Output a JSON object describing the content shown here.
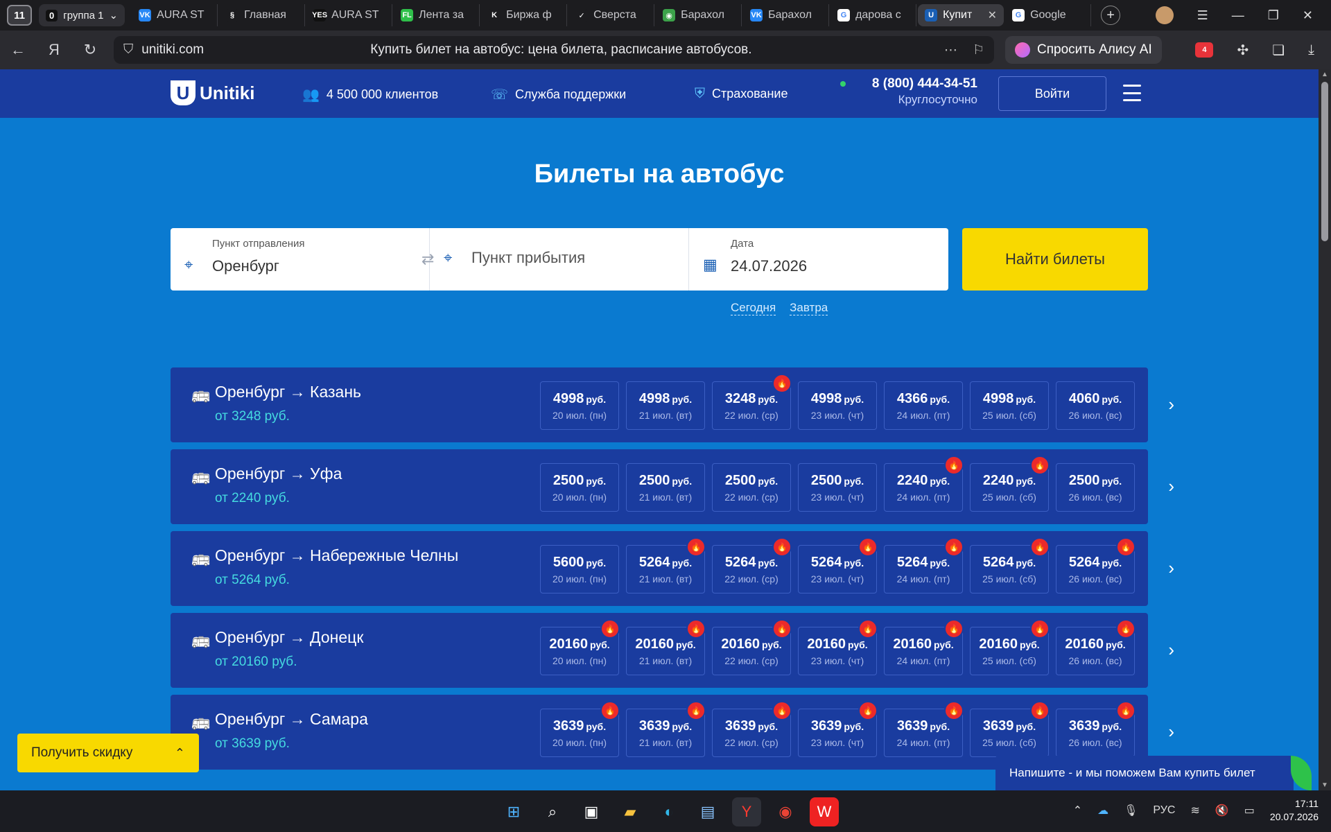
{
  "browser": {
    "tab_counter": "11",
    "group": {
      "count": "0",
      "label": "группа 1"
    },
    "tabs": [
      {
        "title": "AURA ST",
        "fav_bg": "#2787f5",
        "fav_glyph": "VK"
      },
      {
        "title": "Главная",
        "fav_bg": "#1c1c1f",
        "fav_glyph": "§"
      },
      {
        "title": "AURA ST",
        "fav_bg": "#111111",
        "fav_glyph": "YES"
      },
      {
        "title": "Лента за",
        "fav_bg": "#2fbf4a",
        "fav_glyph": "FL"
      },
      {
        "title": "Биржа ф",
        "fav_bg": "#1c1c1f",
        "fav_glyph": "K"
      },
      {
        "title": "Сверста",
        "fav_bg": "#1c1c1f",
        "fav_glyph": "✓"
      },
      {
        "title": "Барахол",
        "fav_bg": "#3ca24a",
        "fav_glyph": "◉"
      },
      {
        "title": "Барахол",
        "fav_bg": "#2787f5",
        "fav_glyph": "VK"
      },
      {
        "title": "дарова с",
        "fav_bg": "#ffffff",
        "fav_glyph": "G"
      },
      {
        "title": "Купит",
        "fav_bg": "#1a5fb4",
        "fav_glyph": "U",
        "active": true
      },
      {
        "title": "Google",
        "fav_bg": "#ffffff",
        "fav_glyph": "G"
      }
    ],
    "url_domain": "unitiki.com",
    "page_title": "Купить билет на автобус: цена билета, расписание автобусов.",
    "alice_label": "Спросить Алису AI",
    "ext_badge": "4"
  },
  "site": {
    "logo": "Unitiki",
    "clients": "4 500 000 клиентов",
    "support": "Служба поддержки",
    "insurance": "Страхование",
    "phone": "8 (800) 444-34-51",
    "phone_sub": "Круглосуточно",
    "login": "Войти"
  },
  "hero": {
    "title": "Билеты на автобус"
  },
  "search": {
    "from_label": "Пункт отправления",
    "from_value": "Оренбург",
    "to_placeholder": "Пункт прибытия",
    "date_label": "Дата",
    "date_value": "24.07.2026",
    "find_button": "Найти билеты",
    "today": "Сегодня",
    "tomorrow": "Завтра"
  },
  "currency": "руб.",
  "routes": [
    {
      "name": "Оренбург → Казань",
      "from_price": "от 3248 руб.",
      "days": [
        {
          "price": "4998",
          "date": "20 июл. (пн)",
          "hot": false
        },
        {
          "price": "4998",
          "date": "21 июл. (вт)",
          "hot": false
        },
        {
          "price": "3248",
          "date": "22 июл. (ср)",
          "hot": true
        },
        {
          "price": "4998",
          "date": "23 июл. (чт)",
          "hot": false
        },
        {
          "price": "4366",
          "date": "24 июл. (пт)",
          "hot": false
        },
        {
          "price": "4998",
          "date": "25 июл. (сб)",
          "hot": false
        },
        {
          "price": "4060",
          "date": "26 июл. (вс)",
          "hot": false
        }
      ]
    },
    {
      "name": "Оренбург → Уфа",
      "from_price": "от 2240 руб.",
      "days": [
        {
          "price": "2500",
          "date": "20 июл. (пн)",
          "hot": false
        },
        {
          "price": "2500",
          "date": "21 июл. (вт)",
          "hot": false
        },
        {
          "price": "2500",
          "date": "22 июл. (ср)",
          "hot": false
        },
        {
          "price": "2500",
          "date": "23 июл. (чт)",
          "hot": false
        },
        {
          "price": "2240",
          "date": "24 июл. (пт)",
          "hot": true
        },
        {
          "price": "2240",
          "date": "25 июл. (сб)",
          "hot": true
        },
        {
          "price": "2500",
          "date": "26 июл. (вс)",
          "hot": false
        }
      ]
    },
    {
      "name": "Оренбург → Набережные Челны",
      "from_price": "от 5264 руб.",
      "days": [
        {
          "price": "5600",
          "date": "20 июл. (пн)",
          "hot": false
        },
        {
          "price": "5264",
          "date": "21 июл. (вт)",
          "hot": true
        },
        {
          "price": "5264",
          "date": "22 июл. (ср)",
          "hot": true
        },
        {
          "price": "5264",
          "date": "23 июл. (чт)",
          "hot": true
        },
        {
          "price": "5264",
          "date": "24 июл. (пт)",
          "hot": true
        },
        {
          "price": "5264",
          "date": "25 июл. (сб)",
          "hot": true
        },
        {
          "price": "5264",
          "date": "26 июл. (вс)",
          "hot": true
        }
      ]
    },
    {
      "name": "Оренбург → Донецк",
      "from_price": "от 20160 руб.",
      "days": [
        {
          "price": "20160",
          "date": "20 июл. (пн)",
          "hot": true
        },
        {
          "price": "20160",
          "date": "21 июл. (вт)",
          "hot": true
        },
        {
          "price": "20160",
          "date": "22 июл. (ср)",
          "hot": true
        },
        {
          "price": "20160",
          "date": "23 июл. (чт)",
          "hot": true
        },
        {
          "price": "20160",
          "date": "24 июл. (пт)",
          "hot": true
        },
        {
          "price": "20160",
          "date": "25 июл. (сб)",
          "hot": true
        },
        {
          "price": "20160",
          "date": "26 июл. (вс)",
          "hot": true
        }
      ]
    },
    {
      "name": "Оренбург → Самара",
      "from_price": "от 3639 руб.",
      "days": [
        {
          "price": "3639",
          "date": "20 июл. (пн)",
          "hot": true
        },
        {
          "price": "3639",
          "date": "21 июл. (вт)",
          "hot": true
        },
        {
          "price": "3639",
          "date": "22 июл. (ср)",
          "hot": true
        },
        {
          "price": "3639",
          "date": "23 июл. (чт)",
          "hot": true
        },
        {
          "price": "3639",
          "date": "24 июл. (пт)",
          "hot": true
        },
        {
          "price": "3639",
          "date": "25 июл. (сб)",
          "hot": true
        },
        {
          "price": "3639",
          "date": "26 июл. (вс)",
          "hot": true
        }
      ]
    }
  ],
  "discount": {
    "label": "Получить скидку"
  },
  "chat": {
    "label": "Напишите - и мы поможем Вам купить билет"
  },
  "taskbar": {
    "lang": "РУС",
    "time": "17:11",
    "date": "20.07.2026"
  },
  "colors": {
    "page_bg": "#0a7ad0",
    "header_bg": "#1a3c9f",
    "accent_yellow": "#f8d900",
    "from_price": "#45dbe0",
    "hot_badge": "#ec2a2a"
  }
}
